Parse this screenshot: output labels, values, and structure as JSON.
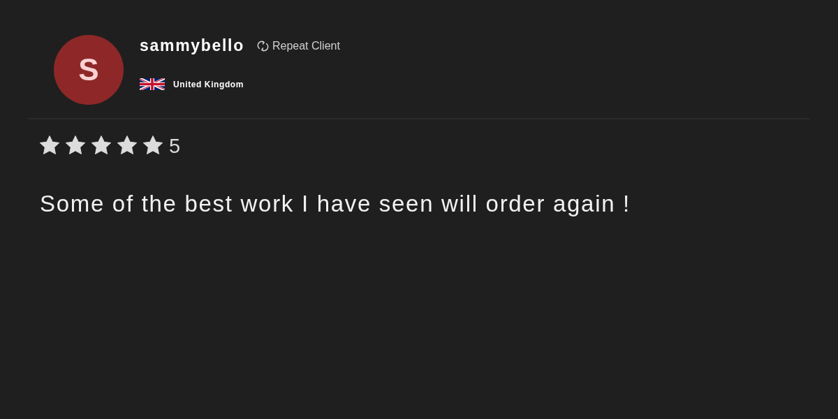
{
  "review": {
    "avatar": {
      "initial": "S"
    },
    "username": "sammybello",
    "badge": {
      "label": "Repeat Client"
    },
    "country": {
      "name": "United Kingdom"
    },
    "rating": {
      "stars": 5,
      "label": "5"
    },
    "text": "Some of the best work I have seen will order again !"
  }
}
